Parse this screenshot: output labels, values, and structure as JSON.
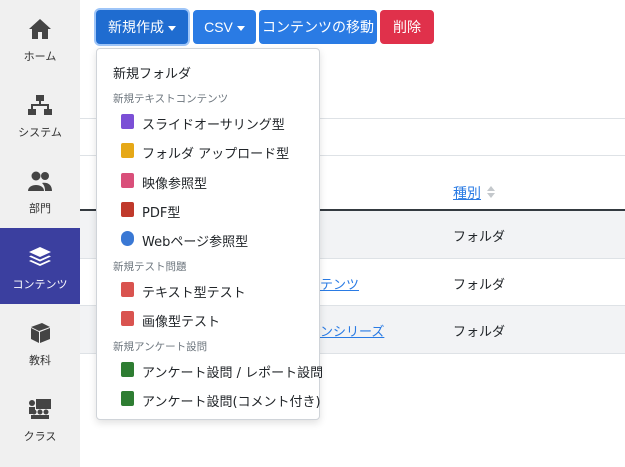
{
  "sidebar": {
    "items": [
      {
        "label": "ホーム",
        "icon": "home-icon"
      },
      {
        "label": "システム",
        "icon": "sitemap-icon"
      },
      {
        "label": "部門",
        "icon": "users-icon"
      },
      {
        "label": "コンテンツ",
        "icon": "layers-icon",
        "active": true
      },
      {
        "label": "教科",
        "icon": "book-icon"
      },
      {
        "label": "クラス",
        "icon": "classroom-icon"
      }
    ]
  },
  "toolbar": {
    "new_label": "新規作成",
    "csv_label": "CSV",
    "move_label": "コンテンツの移動",
    "delete_label": "削除"
  },
  "table": {
    "type_header": "種別",
    "rows": [
      {
        "name": "",
        "type": "フォルダ"
      },
      {
        "name": "テンツ",
        "type": "フォルダ"
      },
      {
        "name": "ンシリーズ",
        "type": "フォルダ"
      }
    ]
  },
  "dropdown": {
    "new_folder": "新規フォルダ",
    "section_text": "新規テキストコンテンツ",
    "text_items": [
      {
        "label": "スライドオーサリング型",
        "icon": "slide-authoring-icon",
        "color": "#7b4fd6"
      },
      {
        "label": "フォルダ アップロード型",
        "icon": "folder-upload-icon",
        "color": "#e6a817"
      },
      {
        "label": "映像参照型",
        "icon": "video-icon",
        "color": "#d94f7a"
      },
      {
        "label": "PDF型",
        "icon": "pdf-icon",
        "color": "#c0392b"
      },
      {
        "label": "Webページ参照型",
        "icon": "web-icon",
        "color": "#3a78d4"
      }
    ],
    "section_test": "新規テスト問題",
    "test_items": [
      {
        "label": "テキスト型テスト",
        "icon": "text-test-icon",
        "color": "#d9534f"
      },
      {
        "label": "画像型テスト",
        "icon": "image-test-icon",
        "color": "#d9534f"
      }
    ],
    "section_survey": "新規アンケート設問",
    "survey_items": [
      {
        "label": "アンケート設問 / レポート設問",
        "icon": "survey-icon",
        "color": "#2e7d32"
      },
      {
        "label": "アンケート設問(コメント付き)",
        "icon": "survey-comment-icon",
        "color": "#2e7d32"
      }
    ]
  },
  "colors": {
    "primary": "#2a7be4",
    "danger": "#e0314b",
    "sidebar_active": "#3b3f9f"
  }
}
